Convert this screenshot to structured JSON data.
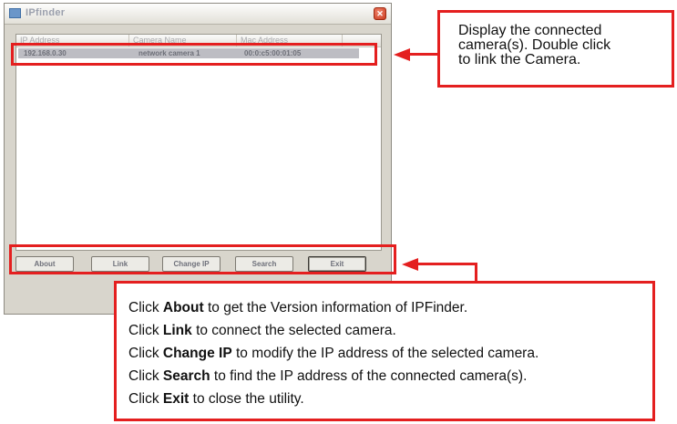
{
  "window": {
    "title": "IPfinder",
    "columns": [
      "IP Address",
      "Camera Name",
      "Mac Address"
    ],
    "rows": [
      {
        "ip": "192.168.0.30",
        "name": "network camera 1",
        "mac": "00:0:c5:00:01:05"
      }
    ],
    "buttons": {
      "about": "About",
      "link": "Link",
      "change_ip": "Change IP",
      "search": "Search",
      "exit": "Exit"
    }
  },
  "callout_list": {
    "line1": "Display the connected",
    "line2": "camera(s). Double click",
    "line3": "to link the Camera."
  },
  "callout_buttons": [
    {
      "prefix": "Click ",
      "keyword": "About",
      "text": " to get the Version information of IPFinder."
    },
    {
      "prefix": "Click ",
      "keyword": "Link",
      "text": " to connect the selected camera."
    },
    {
      "prefix": "Click ",
      "keyword": "Change IP",
      "text": " to modify the IP address of the selected camera."
    },
    {
      "prefix": "Click ",
      "keyword": "Search",
      "text": " to find the IP address of the connected camera(s)."
    },
    {
      "prefix": "Click ",
      "keyword": "Exit",
      "text": " to close the utility."
    }
  ],
  "colors": {
    "highlight": "#e41f1f",
    "window_bg": "#d8d5cc",
    "selected_row": "#bdbdc3"
  },
  "icons": [
    "app-icon",
    "close-icon",
    "arrow-left-icon"
  ]
}
